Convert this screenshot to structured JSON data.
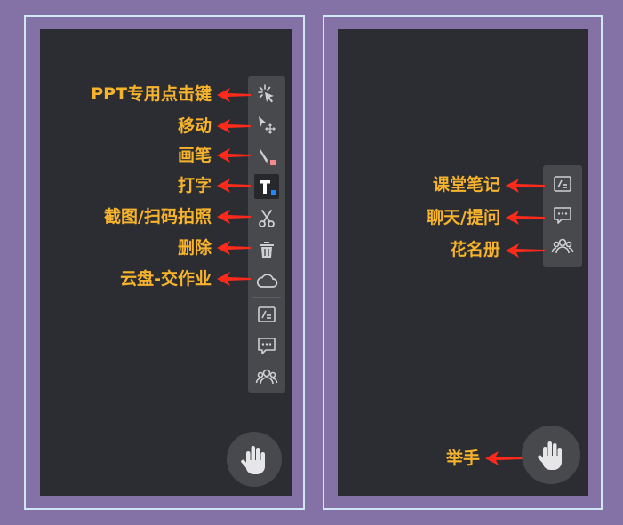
{
  "left_panel": {
    "tools": [
      {
        "name": "ppt-click-icon",
        "label": "PPT专用点击键"
      },
      {
        "name": "move-icon",
        "label": "移动"
      },
      {
        "name": "pen-icon",
        "label": "画笔"
      },
      {
        "name": "text-icon",
        "label": "打字"
      },
      {
        "name": "scissors-icon",
        "label": "截图/扫码拍照"
      },
      {
        "name": "trash-icon",
        "label": "删除"
      },
      {
        "name": "cloud-icon",
        "label": "云盘-交作业"
      }
    ],
    "extra_tools": [
      {
        "name": "notes-icon"
      },
      {
        "name": "chat-icon"
      },
      {
        "name": "roster-icon"
      }
    ]
  },
  "right_panel": {
    "tools": [
      {
        "name": "notes-icon",
        "label": "课堂笔记"
      },
      {
        "name": "chat-icon",
        "label": "聊天/提问"
      },
      {
        "name": "roster-icon",
        "label": "花名册"
      }
    ],
    "raise_hand_label": "举手"
  },
  "colors": {
    "background": "#8471a5",
    "panel": "#2c2d32",
    "toolbar": "#48494d",
    "label": "#f7b32b",
    "arrow": "#ff2a1a",
    "frame": "#cfe6f3",
    "text_accent_blue": "#1e88ff",
    "pen_accent_pink": "#f48a8a"
  }
}
